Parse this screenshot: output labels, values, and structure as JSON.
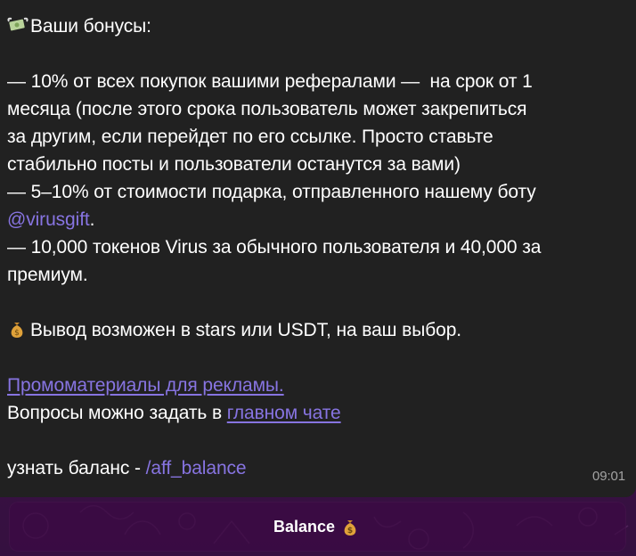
{
  "message": {
    "header_icon": "money-with-wings-icon",
    "header": "Ваши бонусы:",
    "lines": [
      "— 10% от всех покупок вашими рефералами —  на срок от 1",
      "месяца (после этого срока пользователь может закрепиться",
      "за другим, если перейдет по его ссылке. Просто ставьте",
      "стабильно посты и пользователи останутся за вами)",
      "— 5–10% от стоимости подарка, отправленного нашему боту"
    ],
    "mention": "@virusgift",
    "mention_suffix": ".",
    "line_tokens_1": "— 10,000 токенов Virus за обычного пользователя и 40,000 за",
    "line_tokens_2": "премиум.",
    "withdraw_icon": "money-bag-icon",
    "withdraw": "Вывод возможен в stars или USDT, на ваш выбор.",
    "promo_link": "Промоматериалы для рекламы.",
    "questions_prefix": "Вопросы можно задать в ",
    "questions_link": "главном чате",
    "balance_prefix": "узнать баланс - ",
    "balance_command": "/aff_balance",
    "time": "09:01"
  },
  "keyboard": {
    "button_label": "Balance",
    "button_icon": "money-bag-icon"
  },
  "colors": {
    "bubble_bg": "#212121",
    "link": "#8774e1",
    "time": "#a3a3a3",
    "wallpaper": "#3a1142"
  }
}
